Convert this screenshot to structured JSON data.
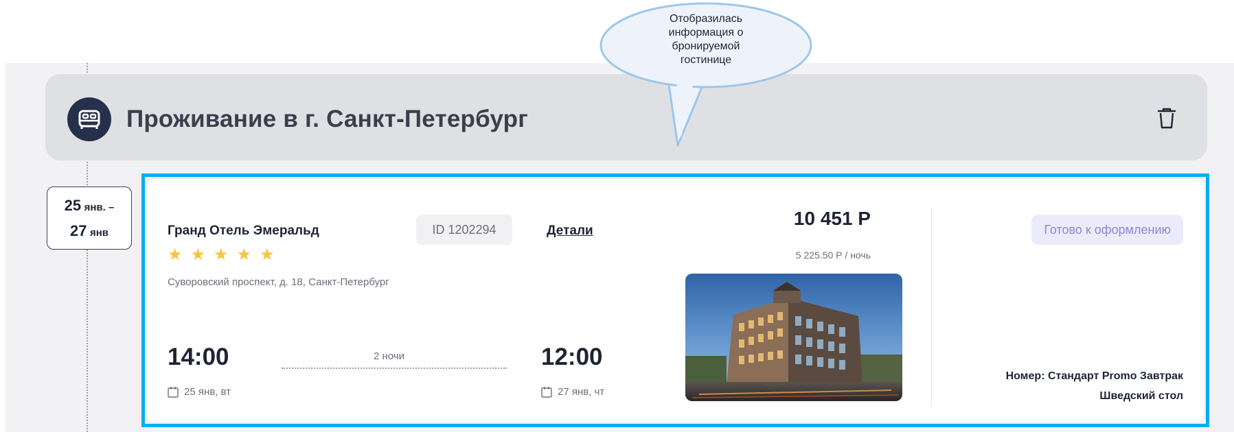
{
  "section": {
    "title": "Проживание в г. Санкт-Петербург",
    "icon": "bed-icon",
    "delete_icon": "trash-icon"
  },
  "date_badge": {
    "start_day": "25",
    "start_month": "янв. –",
    "end_day": "27",
    "end_month": "янв"
  },
  "hotel": {
    "name": "Гранд Отель Эмеральд",
    "id_label": "ID 1202294",
    "details_label": "Детали",
    "stars": 5,
    "address": "Суворовский проспект, д. 18, Санкт-Петербург",
    "checkin_time": "14:00",
    "checkin_date": "25 янв, вт",
    "nights": "2 ночи",
    "checkout_time": "12:00",
    "checkout_date": "27 янв, чт",
    "price": "10 451 Р",
    "price_per_night": "5 225.50 Р / ночь",
    "status": "Готово к оформлению",
    "room_line1": "Номер: Стандарт Promo Завтрак",
    "room_line2": "Шведский стол"
  },
  "annotation": {
    "line1": "Отобразилась",
    "line2": "информация о",
    "line3": "бронируемой",
    "line4": "гостинице"
  },
  "colors": {
    "highlight": "#00aeef",
    "header_bg": "#dfe0e4",
    "icon_circle": "#26304b",
    "star": "#f5c542",
    "status_bg": "#ecebfb",
    "status_text": "#8b87d6",
    "bubble_fill": "#eef3fb",
    "bubble_stroke": "#9cc7ea"
  }
}
